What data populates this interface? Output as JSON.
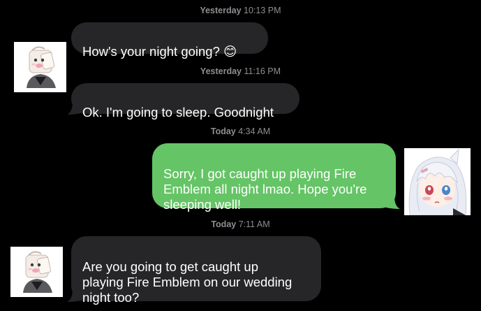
{
  "conversation": {
    "messages": [
      {
        "timestamp_day": "Yesterday",
        "timestamp_time": "10:13 PM",
        "text": "How's your night going? ",
        "emoji": "😊",
        "direction": "incoming"
      },
      {
        "timestamp_day": "Yesterday",
        "timestamp_time": "11:16 PM",
        "text": "Ok. I'm going to sleep. Goodnight",
        "direction": "incoming"
      },
      {
        "timestamp_day": "Today",
        "timestamp_time": "4:34 AM",
        "text": "Sorry, I got caught up playing Fire\nEmblem all night lmao. Hope you're\nsleeping well!",
        "direction": "outgoing"
      },
      {
        "timestamp_day": "Today",
        "timestamp_time": "7:11 AM",
        "text": "Are you going to get caught up\nplaying Fire Emblem on our wedding\nnight too?",
        "direction": "incoming"
      }
    ]
  },
  "colors": {
    "background": "#000000",
    "incoming_bubble": "#262628",
    "outgoing_bubble": "#65c466",
    "timestamp": "#8e8e93"
  },
  "icons": {
    "contact_avatar": "anime-chibi-character-avatar",
    "user_avatar": "anime-white-haired-girl-avatar",
    "emoji": "smiling-face-emoji"
  }
}
